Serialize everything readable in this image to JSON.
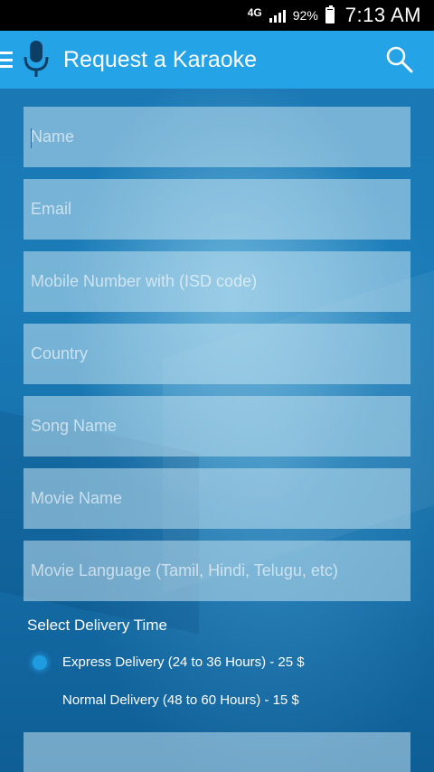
{
  "status_bar": {
    "network": "4G",
    "battery": "92%",
    "time": "7:13 AM"
  },
  "app_bar": {
    "title": "Request a Karaoke"
  },
  "form": {
    "fields": [
      {
        "placeholder": "Name"
      },
      {
        "placeholder": "Email"
      },
      {
        "placeholder": "Mobile Number with (ISD code)"
      },
      {
        "placeholder": "Country"
      },
      {
        "placeholder": "Song Name"
      },
      {
        "placeholder": "Movie Name"
      },
      {
        "placeholder": "Movie Language (Tamil, Hindi, Telugu, etc)"
      }
    ],
    "delivery_heading": "Select Delivery Time",
    "delivery_options": [
      {
        "label": "Express Delivery (24 to 36 Hours) - 25 $",
        "selected": true
      },
      {
        "label": "Normal Delivery (48 to 60 Hours) - 15 $",
        "selected": false
      }
    ]
  },
  "colors": {
    "app_bar": "#24a3e6",
    "status_bar": "#000000",
    "radio_selected": "#1f9be0"
  }
}
